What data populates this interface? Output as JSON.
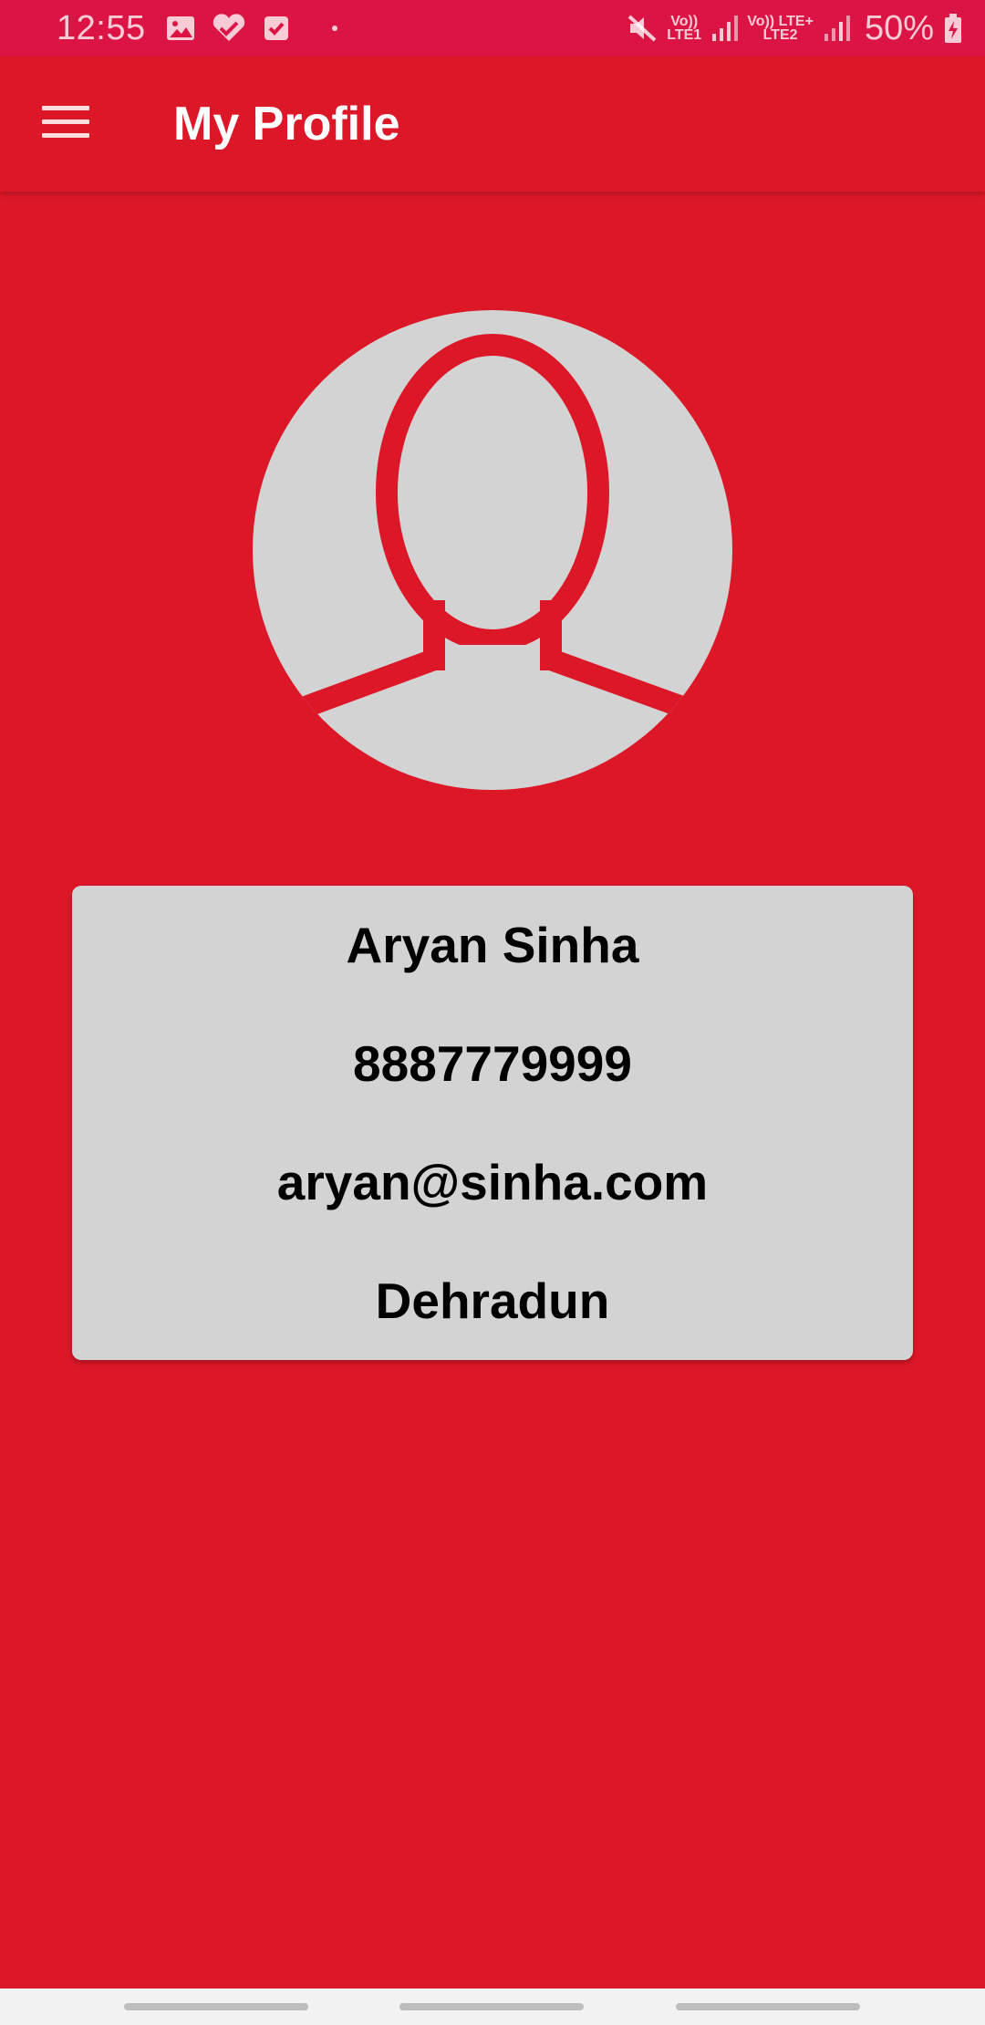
{
  "status_bar": {
    "time": "12:55",
    "left_icons": [
      "gallery-icon",
      "health-icon",
      "task-icon",
      "notification-dot"
    ],
    "right_icons": [
      "mute-icon",
      "volte-lte1-icon",
      "signal-icon",
      "volte-lte2-icon",
      "signal-icon",
      "battery-icon"
    ],
    "lte1_top": "Vo))",
    "lte1_bottom": "LTE1",
    "lte2_top": "Vo)) LTE+",
    "lte2_bottom": "LTE2",
    "battery": "50%"
  },
  "app_bar": {
    "title": "My Profile",
    "menu_icon": "hamburger-menu-icon"
  },
  "avatar": {
    "icon": "user-avatar-icon",
    "circle_color": "#D3D3D3",
    "outline_color": "#DC1728"
  },
  "profile": {
    "name": "Aryan Sinha",
    "phone": "8887779999",
    "email": "aryan@sinha.com",
    "city": "Dehradun"
  },
  "colors": {
    "primary": "#DC1728",
    "status_bar": "#DC1446",
    "card": "#D3D3D3",
    "nav_bar": "#F2F2F2"
  }
}
